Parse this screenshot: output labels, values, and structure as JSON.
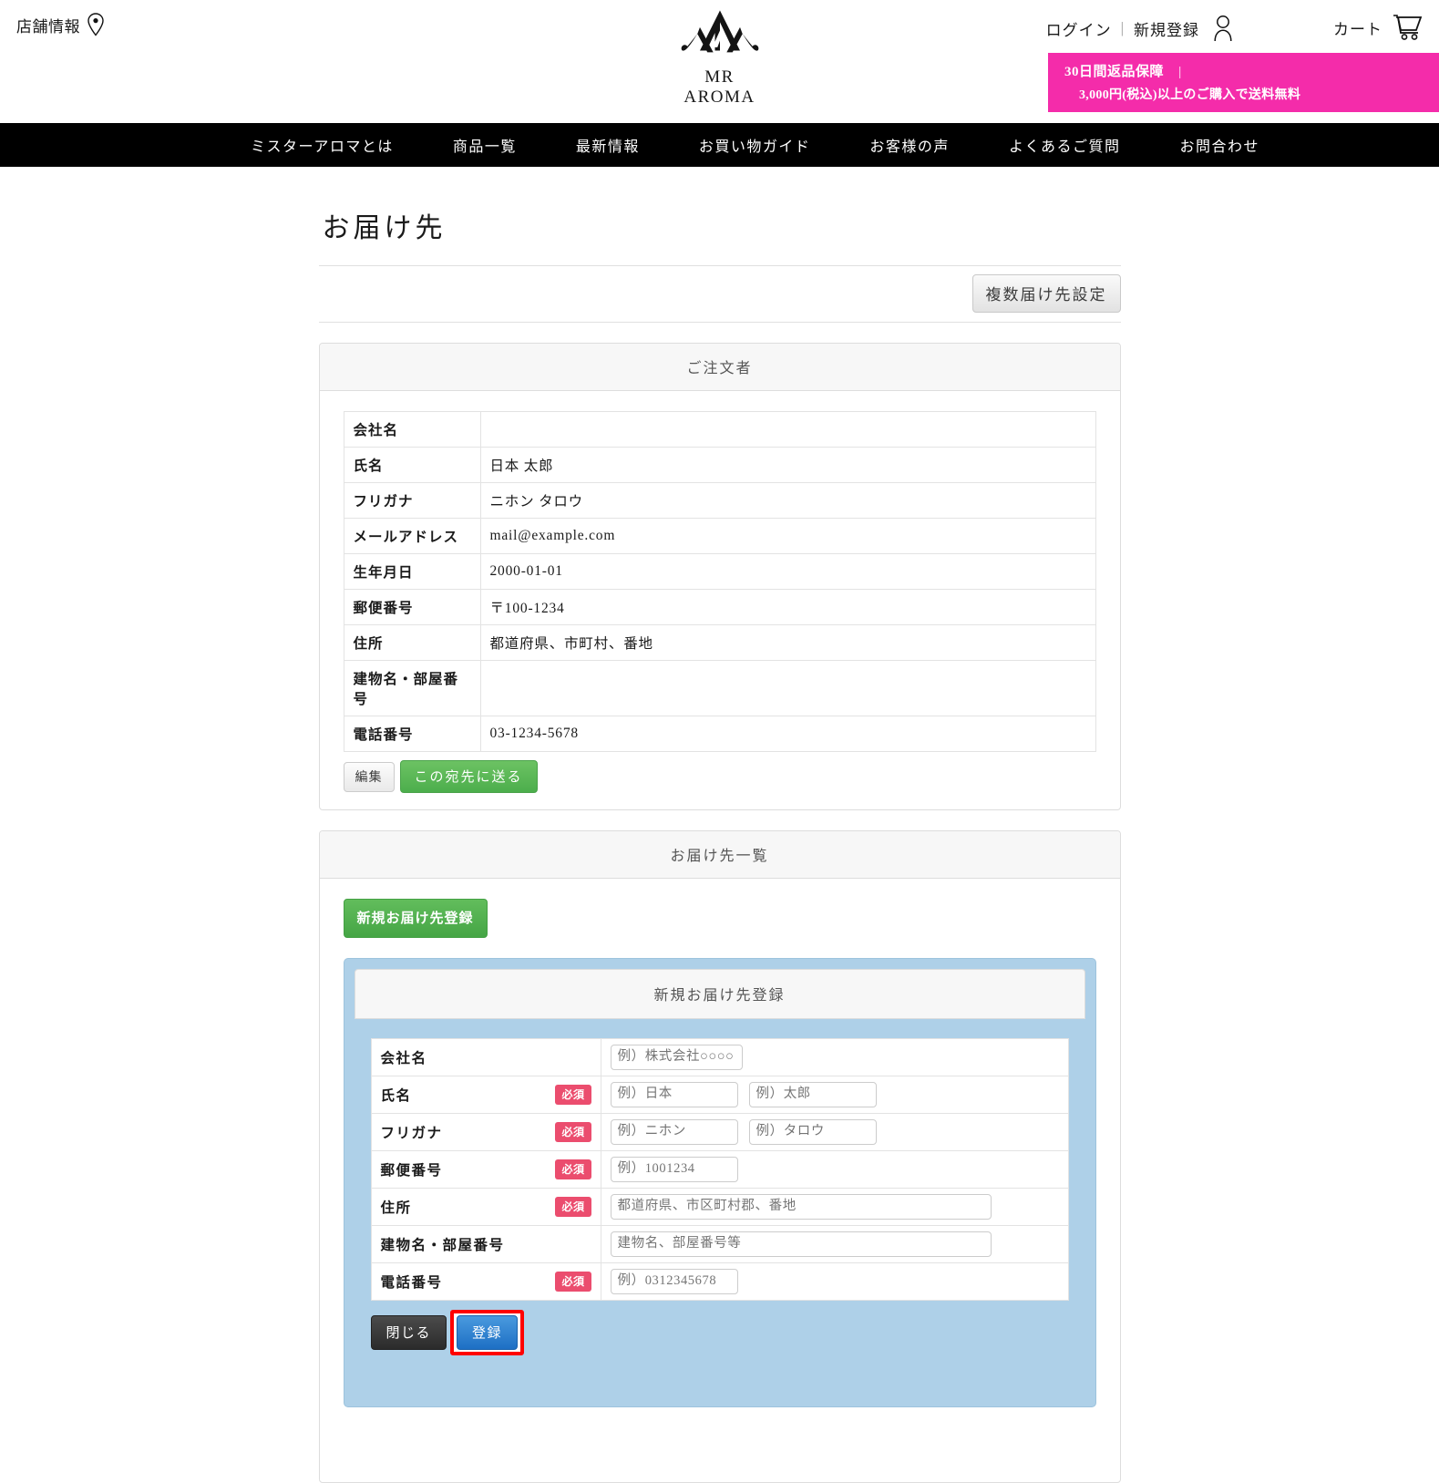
{
  "header": {
    "store_info_label": "店舗情報",
    "pin_icon": "map-pin-icon",
    "logo_line1": "MR",
    "logo_line2": "AROMA",
    "login_label": "ログイン",
    "separator": "|",
    "register_label": "新規登録",
    "person_icon": "person-icon",
    "cart_label": "カート",
    "cart_icon": "shopping-cart-icon",
    "promo_line1": "30日間返品保障",
    "promo_divider": "|",
    "promo_line2": "3,000円(税込)以上のご購入で送料無料",
    "promo_bg_color": "#f42caa"
  },
  "nav": {
    "items": [
      {
        "label": "ミスターアロマとは"
      },
      {
        "label": "商品一覧"
      },
      {
        "label": "最新情報"
      },
      {
        "label": "お買い物ガイド"
      },
      {
        "label": "お客様の声"
      },
      {
        "label": "よくあるご質問"
      },
      {
        "label": "お問合わせ"
      }
    ]
  },
  "main": {
    "page_title": "お届け先",
    "multi_shipping_button": "複数届け先設定",
    "orderer_panel": {
      "heading": "ご注文者",
      "rows": [
        {
          "label": "会社名",
          "value": ""
        },
        {
          "label": "氏名",
          "value": "日本 太郎"
        },
        {
          "label": "フリガナ",
          "value": "ニホン タロウ"
        },
        {
          "label": "メールアドレス",
          "value": "mail@example.com"
        },
        {
          "label": "生年月日",
          "value": "2000-01-01"
        },
        {
          "label": "郵便番号",
          "value": "〒100-1234"
        },
        {
          "label": "住所",
          "value": "都道府県、市町村、番地"
        },
        {
          "label": "建物名・部屋番号",
          "value": ""
        },
        {
          "label": "電話番号",
          "value": "03-1234-5678"
        }
      ],
      "edit_button": "編集",
      "send_here_button": "この宛先に送る"
    },
    "shipping_list_panel": {
      "heading": "お届け先一覧",
      "new_address_button": "新規お届け先登録",
      "form_panel": {
        "heading": "新規お届け先登録",
        "required_badge": "必須",
        "rows": [
          {
            "label": "会社名",
            "required": false,
            "inputs": [
              {
                "placeholder": "例）株式会社○○○○",
                "value": "",
                "size": "md"
              }
            ]
          },
          {
            "label": "氏名",
            "required": true,
            "inputs": [
              {
                "placeholder": "例）日本",
                "value": "",
                "size": "sm"
              },
              {
                "placeholder": "例）太郎",
                "value": "",
                "size": "sm"
              }
            ]
          },
          {
            "label": "フリガナ",
            "required": true,
            "inputs": [
              {
                "placeholder": "例）ニホン",
                "value": "",
                "size": "sm"
              },
              {
                "placeholder": "例）タロウ",
                "value": "",
                "size": "sm"
              }
            ]
          },
          {
            "label": "郵便番号",
            "required": true,
            "inputs": [
              {
                "placeholder": "例）1001234",
                "value": "",
                "size": "sm"
              }
            ]
          },
          {
            "label": "住所",
            "required": true,
            "inputs": [
              {
                "placeholder": "都道府県、市区町村郡、番地",
                "value": "",
                "size": "lg"
              }
            ]
          },
          {
            "label": "建物名・部屋番号",
            "required": false,
            "inputs": [
              {
                "placeholder": "建物名、部屋番号等",
                "value": "",
                "size": "lg"
              }
            ]
          },
          {
            "label": "電話番号",
            "required": true,
            "inputs": [
              {
                "placeholder": "例）0312345678",
                "value": "",
                "size": "sm"
              }
            ]
          }
        ],
        "close_button": "閉じる",
        "register_button": "登録",
        "highlight_color": "#ff0000",
        "panel_bg_color": "#aed0e8"
      }
    }
  }
}
